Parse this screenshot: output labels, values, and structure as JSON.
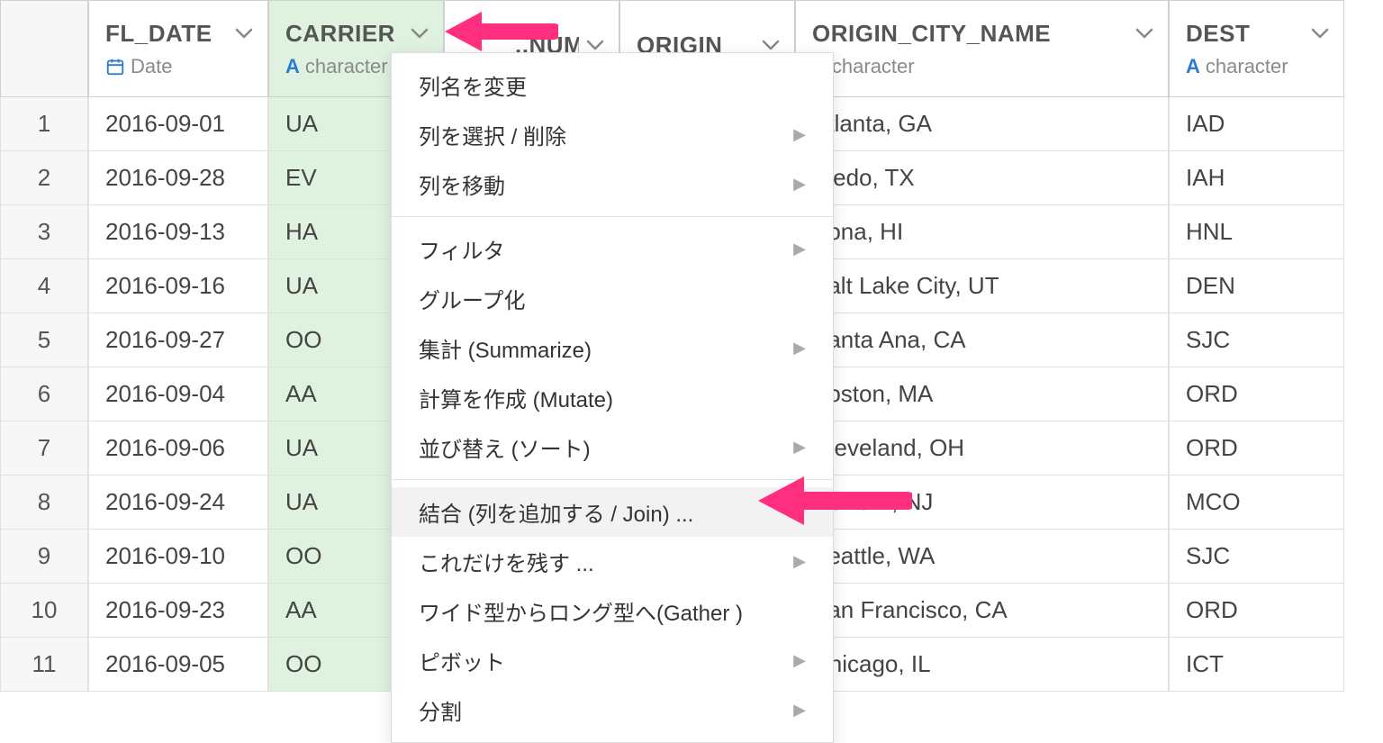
{
  "columns": [
    {
      "name": "FL_DATE",
      "type": "Date",
      "icon": "date",
      "selected": false
    },
    {
      "name": "CARRIER",
      "type": "character",
      "icon": "char",
      "selected": true
    },
    {
      "name": "..NUM",
      "type": "",
      "icon": "char",
      "selected": false
    },
    {
      "name": "ORIGIN",
      "type": "",
      "icon": "char",
      "selected": false
    },
    {
      "name": "ORIGIN_CITY_NAME",
      "type": "character",
      "icon": "char",
      "selected": false
    },
    {
      "name": "DEST",
      "type": "character",
      "icon": "char",
      "selected": false
    }
  ],
  "rows": [
    {
      "n": "1",
      "FL_DATE": "2016-09-01",
      "CARRIER": "UA",
      "NUM": "",
      "ORIGIN": "",
      "ORIGIN_CITY_NAME": "Atlanta, GA",
      "DEST": "IAD"
    },
    {
      "n": "2",
      "FL_DATE": "2016-09-28",
      "CARRIER": "EV",
      "NUM": "",
      "ORIGIN": "",
      "ORIGIN_CITY_NAME": "aredo, TX",
      "DEST": "IAH"
    },
    {
      "n": "3",
      "FL_DATE": "2016-09-13",
      "CARRIER": "HA",
      "NUM": "",
      "ORIGIN": "",
      "ORIGIN_CITY_NAME": "Kona, HI",
      "DEST": "HNL"
    },
    {
      "n": "4",
      "FL_DATE": "2016-09-16",
      "CARRIER": "UA",
      "NUM": "",
      "ORIGIN": "",
      "ORIGIN_CITY_NAME": "Salt Lake City, UT",
      "DEST": "DEN"
    },
    {
      "n": "5",
      "FL_DATE": "2016-09-27",
      "CARRIER": "OO",
      "NUM": "",
      "ORIGIN": "",
      "ORIGIN_CITY_NAME": "Santa Ana, CA",
      "DEST": "SJC"
    },
    {
      "n": "6",
      "FL_DATE": "2016-09-04",
      "CARRIER": "AA",
      "NUM": "",
      "ORIGIN": "",
      "ORIGIN_CITY_NAME": "Boston, MA",
      "DEST": "ORD"
    },
    {
      "n": "7",
      "FL_DATE": "2016-09-06",
      "CARRIER": "UA",
      "NUM": "",
      "ORIGIN": "",
      "ORIGIN_CITY_NAME": "Cleveland, OH",
      "DEST": "ORD"
    },
    {
      "n": "8",
      "FL_DATE": "2016-09-24",
      "CARRIER": "UA",
      "NUM": "",
      "ORIGIN": "",
      "ORIGIN_CITY_NAME": "Newark, NJ",
      "DEST": "MCO"
    },
    {
      "n": "9",
      "FL_DATE": "2016-09-10",
      "CARRIER": "OO",
      "NUM": "",
      "ORIGIN": "",
      "ORIGIN_CITY_NAME": "Seattle, WA",
      "DEST": "SJC"
    },
    {
      "n": "10",
      "FL_DATE": "2016-09-23",
      "CARRIER": "AA",
      "NUM": "",
      "ORIGIN": "",
      "ORIGIN_CITY_NAME": "San Francisco, CA",
      "DEST": "ORD"
    },
    {
      "n": "11",
      "FL_DATE": "2016-09-05",
      "CARRIER": "OO",
      "NUM": "",
      "ORIGIN": "",
      "ORIGIN_CITY_NAME": "Chicago, IL",
      "DEST": "ICT"
    }
  ],
  "menu": {
    "groups": [
      [
        {
          "label": "列名を変更",
          "sub": false
        },
        {
          "label": "列を選択 / 削除",
          "sub": true
        },
        {
          "label": "列を移動",
          "sub": true
        }
      ],
      [
        {
          "label": "フィルタ",
          "sub": true
        },
        {
          "label": "グループ化",
          "sub": false
        },
        {
          "label": "集計 (Summarize)",
          "sub": true
        },
        {
          "label": "計算を作成 (Mutate)",
          "sub": false
        },
        {
          "label": "並び替え (ソート)",
          "sub": true
        }
      ],
      [
        {
          "label": "結合 (列を追加する / Join) ...",
          "sub": false,
          "hover": true
        },
        {
          "label": "これだけを残す ...",
          "sub": true
        },
        {
          "label": "ワイド型からロング型へ(Gather )",
          "sub": false
        },
        {
          "label": "ピボット",
          "sub": true
        },
        {
          "label": "分割",
          "sub": true
        }
      ]
    ]
  },
  "annotation_color": "#ff2e7e"
}
